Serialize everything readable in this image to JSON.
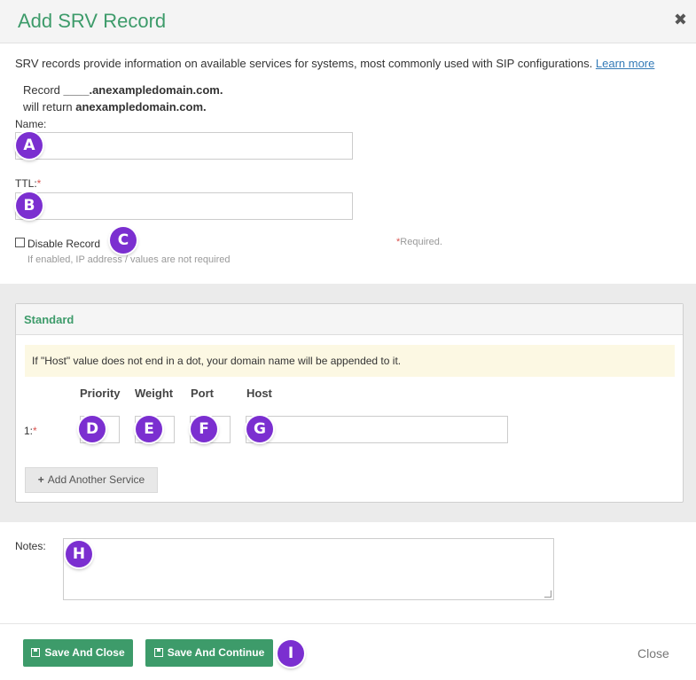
{
  "dialog": {
    "title": "Add SRV Record",
    "close_icon": "close-x-icon"
  },
  "intro": {
    "text": "SRV records provide information on available services for systems, most commonly used with SIP configurations.",
    "learn_more": "Learn more"
  },
  "record_preview": {
    "prefix": "Record",
    "blank": "____",
    "domain": ".anexampledomain.com.",
    "returns_prefix": "will return",
    "returns_domain": "anexampledomain.com."
  },
  "fields": {
    "name_label": "Name:",
    "name_value": "",
    "ttl_label": "TTL:",
    "ttl_value": "",
    "required_star": "*",
    "disable_label": "Disable Record",
    "disable_checked": false,
    "disable_hint": "If enabled, IP address / values are not required",
    "required_note": "*Required."
  },
  "standard": {
    "heading": "Standard",
    "notice": "If \"Host\" value does not end in a dot, your domain name will be appended to it.",
    "columns": [
      "Priority",
      "Weight",
      "Port",
      "Host"
    ],
    "row_label": "1:",
    "row": {
      "priority": "",
      "weight": "",
      "port": "",
      "host": ""
    },
    "add_button": "Add Another Service",
    "add_icon": "plus-icon"
  },
  "notes": {
    "label": "Notes:",
    "value": ""
  },
  "footer": {
    "save_close": "Save And Close",
    "save_continue": "Save And Continue",
    "close": "Close",
    "save_icon": "floppy-disk-icon"
  },
  "markers": [
    "A",
    "B",
    "C",
    "D",
    "E",
    "F",
    "G",
    "H",
    "I"
  ],
  "colors": {
    "accent": "#3d9b6a",
    "marker": "#7b2fd0",
    "required": "#d9534f",
    "notice_bg": "#fcf8e3"
  }
}
